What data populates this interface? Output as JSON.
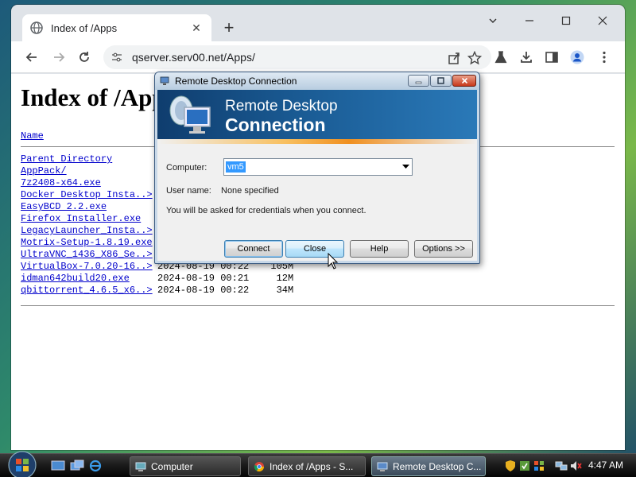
{
  "browser": {
    "tab": {
      "title": "Index of /Apps"
    },
    "newtab_label": "+",
    "url": "qserver.serv00.net/Apps/"
  },
  "page": {
    "heading": "Index of /Apps",
    "column_name": "Name",
    "entries": [
      {
        "name": "Parent Directory",
        "date": "",
        "size": ""
      },
      {
        "name": "AppPack/",
        "date": "",
        "size": ""
      },
      {
        "name": "7z2408-x64.exe",
        "date": "",
        "size": ""
      },
      {
        "name": "Docker Desktop Insta..>",
        "date": "",
        "size": ""
      },
      {
        "name": "EasyBCD 2.2.exe",
        "date": "",
        "size": ""
      },
      {
        "name": "Firefox Installer.exe",
        "date": "",
        "size": ""
      },
      {
        "name": "LegacyLauncher_Insta..>",
        "date": "",
        "size": ""
      },
      {
        "name": "Motrix-Setup-1.8.19.exe",
        "date": "",
        "size": ""
      },
      {
        "name": "UltraVNC_1436_X86_Se..>",
        "date": "",
        "size": ""
      },
      {
        "name": "VirtualBox-7.0.20-16..>",
        "date": "2024-08-19 00:22",
        "size": "105M"
      },
      {
        "name": "idman642build20.exe",
        "date": "2024-08-19 00:21",
        "size": "12M"
      },
      {
        "name": "qbittorrent_4.6.5_x6..>",
        "date": "2024-08-19 00:22",
        "size": "34M"
      }
    ]
  },
  "dialog": {
    "title": "Remote Desktop Connection",
    "banner_line1": "Remote Desktop",
    "banner_line2": "Connection",
    "computer_label": "Computer:",
    "computer_value": "vm5",
    "username_label": "User name:",
    "username_value": "None specified",
    "note": "You will be asked for credentials when you connect.",
    "buttons": {
      "connect": "Connect",
      "close": "Close",
      "help": "Help",
      "options": "Options >>"
    }
  },
  "taskbar": {
    "tasks": [
      {
        "label": "Computer"
      },
      {
        "label": "Index of /Apps - S..."
      },
      {
        "label": "Remote Desktop C..."
      }
    ],
    "clock": "4:47 AM"
  },
  "colors": {
    "link": "#0000cc",
    "banner": "#1a5b94",
    "selection": "#3399ff"
  }
}
